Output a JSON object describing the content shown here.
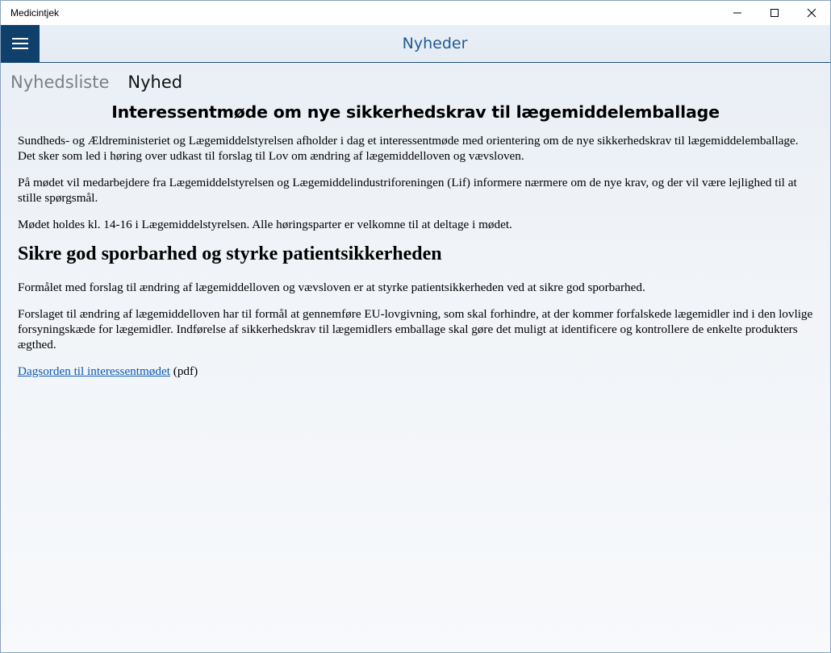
{
  "window": {
    "title": "Medicintjek",
    "controls": {
      "minimize": "minimize-icon",
      "maximize": "maximize-icon",
      "close": "close-icon"
    }
  },
  "navbar": {
    "menu_icon": "hamburger-menu-icon",
    "title": "Nyheder",
    "accent_color": "#0f3f6b",
    "title_color": "#1e5a94"
  },
  "pivot": {
    "tabs": [
      {
        "label": "Nyhedsliste",
        "active": false
      },
      {
        "label": "Nyhed",
        "active": true
      }
    ]
  },
  "article": {
    "title": "Interessentmøde om nye sikkerhedskrav til lægemiddelemballage",
    "paragraphs": [
      "Sundheds- og Ældreministeriet og Lægemiddelstyrelsen afholder i dag et interessentmøde med orientering om de nye sikkerhedskrav til lægemiddelemballage. Det sker som led i høring over udkast til forslag til Lov om ændring af lægemiddelloven og vævsloven.",
      "På mødet vil medarbejdere fra Lægemiddelstyrelsen og Lægemiddelindustriforeningen (Lif) informere nærmere om de nye krav, og der vil være lejlighed til at stille spørgsmål.",
      "Mødet holdes kl. 14-16 i Lægemiddelstyrelsen. Alle høringsparter er velkomne til at deltage i mødet."
    ],
    "subheading": "Sikre god sporbarhed og styrke patientsikkerheden",
    "paragraphs2": [
      "Formålet med forslag til ændring af lægemiddelloven og vævsloven er at styrke patientsikkerheden ved at sikre god sporbarhed.",
      "Forslaget til ændring af lægemiddelloven har til formål at gennemføre EU-lovgivning, som skal forhindre, at der kommer forfalskede lægemidler ind i den lovlige forsyningskæde for lægemidler. Indførelse af sikkerhedskrav til lægemidlers emballage skal gøre det muligt at identificere og kontrollere de enkelte produkters ægthed."
    ],
    "link": {
      "text": "Dagsorden til interessentmødet",
      "suffix": " (pdf)",
      "color": "#0b57b0"
    }
  }
}
